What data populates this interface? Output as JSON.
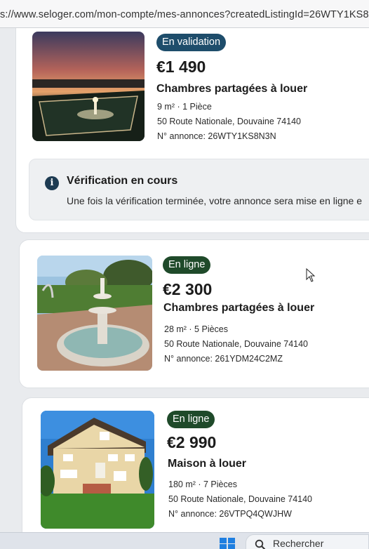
{
  "browser": {
    "url": "s://www.seloger.com/mon-compte/mes-annonces?createdListingId=26WTY1KS8N"
  },
  "listings": [
    {
      "status": "En validation",
      "price": "€1 490",
      "title": "Chambres partagées à louer",
      "details": "9 m² · 1 Pièce",
      "address": "50 Route Nationale, Douvaine 74140",
      "reference": "N° annonce: 26WTY1KS8N3N"
    },
    {
      "status": "En ligne",
      "price": "€2 300",
      "title": "Chambres partagées à louer",
      "details": "28 m² · 5 Pièces",
      "address": "50 Route Nationale, Douvaine 74140",
      "reference": "N° annonce: 261YDM24C2MZ"
    },
    {
      "status": "En ligne",
      "price": "€2 990",
      "title": "Maison à louer",
      "details": "180 m² · 7 Pièces",
      "address": "50 Route Nationale, Douvaine 74140",
      "reference": "N° annonce: 26VTPQ4QWJHW"
    }
  ],
  "verification": {
    "icon": "info-icon",
    "title": "Vérification en cours",
    "message": "Une fois la vérification terminée, votre annonce sera mise en ligne e"
  },
  "taskbar": {
    "search_label": "Rechercher"
  },
  "colors": {
    "pending_badge": "#1e4d6b",
    "online_badge": "#1f4a2a"
  }
}
